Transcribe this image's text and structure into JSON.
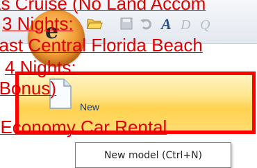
{
  "app_menu": {
    "orb_letter": "e",
    "item": {
      "label": "New",
      "icon": "new-document-icon"
    }
  },
  "quick_access": [
    "open-folder-icon",
    "save-icon",
    "undo-icon",
    "font-a-icon",
    "preview-d-icon",
    "zoom-q-icon"
  ],
  "tooltip": {
    "text": "New model (Ctrl+N)"
  },
  "overlay_lines": [
    "as Cruise (No Land Accom",
    "3 Nights:",
    "oast Central Florida Beach",
    "4 Nights:",
    "(Bonus)",
    "t Economy Car Rental"
  ],
  "colors": {
    "overlay_text": "#e00000",
    "highlight_border": "#ff0000",
    "accent": "#f3a13b"
  }
}
